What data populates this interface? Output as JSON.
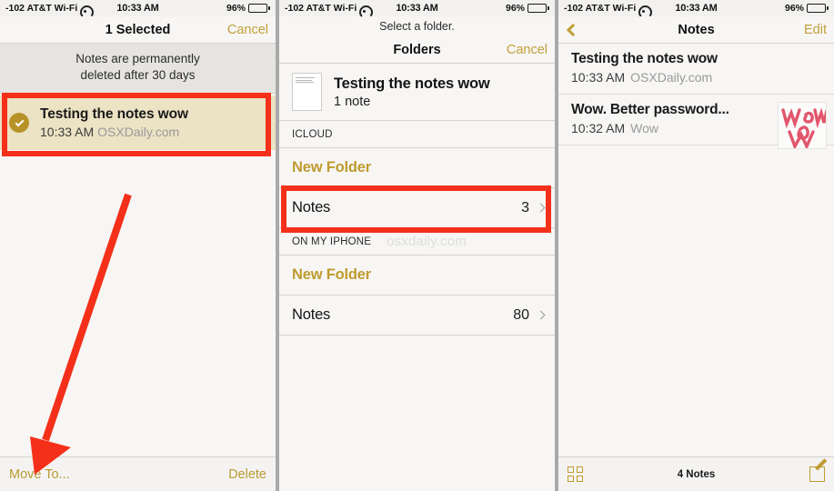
{
  "status_bar": {
    "carrier": "-102 AT&T Wi-Fi",
    "wifi_icon": "wifi-icon",
    "time": "10:33 AM",
    "battery_percent": "96%",
    "battery_icon": "battery-icon"
  },
  "colors": {
    "accent_gold": "#bf9b2f",
    "highlight_red": "#f4301a",
    "selected_row_bg": "#ece2c4",
    "panel_bg": "#f7f6f4"
  },
  "panel1": {
    "nav": {
      "title": "1 Selected",
      "cancel_label": "Cancel"
    },
    "banner": {
      "line1": "Notes are permanently",
      "line2": "deleted after 30 days"
    },
    "selected_note": {
      "check_icon": "check-circle-icon",
      "title": "Testing the notes wow",
      "time": "10:33 AM",
      "source": "OSXDaily.com"
    },
    "toolbar": {
      "move_to_label": "Move To...",
      "delete_label": "Delete"
    },
    "annotation": {
      "arrow_icon": "red-arrow-annotation",
      "box_icon": "red-highlight-box"
    }
  },
  "panel2": {
    "subtitle": "Select a folder.",
    "nav": {
      "title": "Folders",
      "cancel_label": "Cancel"
    },
    "destination": {
      "thumb_icon": "note-page-thumbnail",
      "title": "Testing the notes wow",
      "subtitle": "1 note"
    },
    "sections": [
      {
        "header": "ICLOUD",
        "watermark": "",
        "rows": [
          {
            "label": "New Folder",
            "count": "",
            "style": "new",
            "highlighted": false
          },
          {
            "label": "Notes",
            "count": "3",
            "style": "normal",
            "highlighted": true
          }
        ]
      },
      {
        "header": "ON MY IPHONE",
        "watermark": "osxdaily.com",
        "rows": [
          {
            "label": "New Folder",
            "count": "",
            "style": "new",
            "highlighted": false
          },
          {
            "label": "Notes",
            "count": "80",
            "style": "normal",
            "highlighted": false
          }
        ]
      }
    ]
  },
  "panel3": {
    "nav": {
      "back_icon": "chevron-left-icon",
      "title": "Notes",
      "edit_label": "Edit"
    },
    "notes": [
      {
        "title": "Testing the notes wow",
        "time": "10:33 AM",
        "source": "OSXDaily.com",
        "thumb": ""
      },
      {
        "title": "Wow. Better password...",
        "time": "10:32 AM",
        "source": "Wow",
        "thumb": "wow-handwriting-thumbnail"
      }
    ],
    "toolbar": {
      "grid_icon": "grid-view-icon",
      "count_label": "4 Notes",
      "compose_icon": "compose-note-icon"
    }
  }
}
